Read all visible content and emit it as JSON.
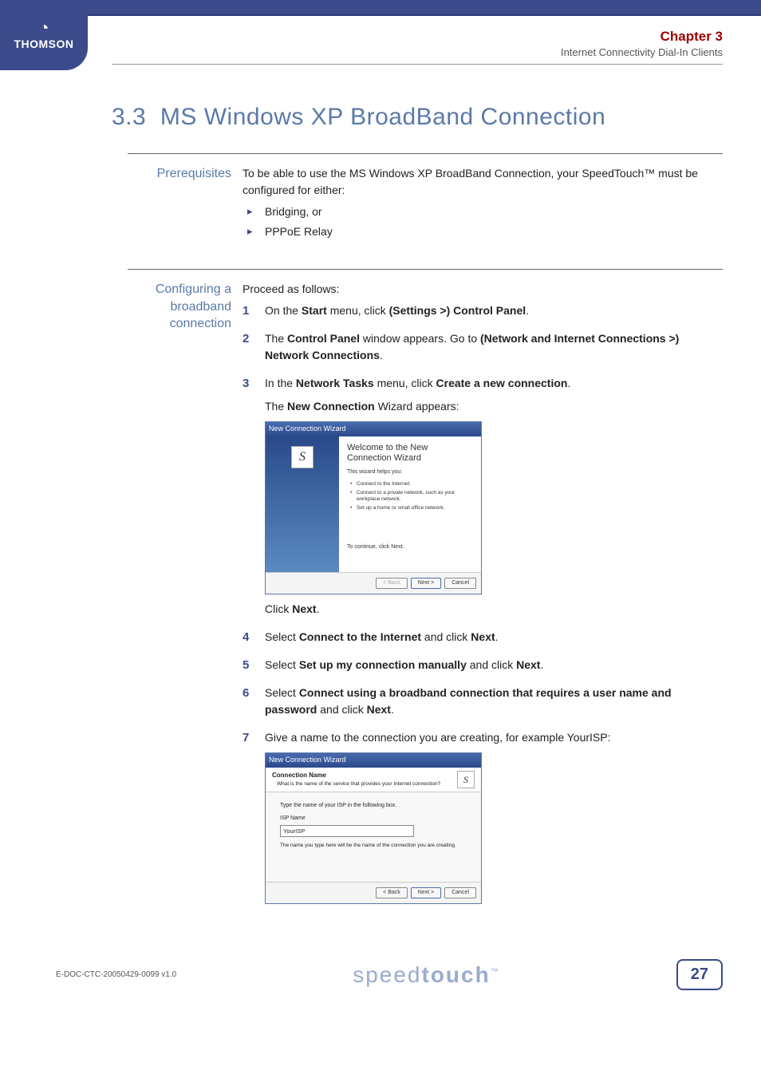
{
  "brand": {
    "logo": "THOMSON",
    "footer_brand_light": "speed",
    "footer_brand_bold": "touch",
    "tm": "™"
  },
  "header": {
    "chapter": "Chapter 3",
    "subtitle": "Internet Connectivity Dial-In Clients"
  },
  "section": {
    "number": "3.3",
    "title": "MS Windows XP BroadBand Connection"
  },
  "prerequisites": {
    "label": "Prerequisites",
    "intro_a": "To be able to use the MS Windows XP BroadBand Connection, your SpeedTouch™ must be configured for either:",
    "items": [
      "Bridging, or",
      "PPPoE Relay"
    ]
  },
  "configuring": {
    "label": "Configuring a broadband connection",
    "intro": "Proceed as follows:",
    "steps": {
      "s1": {
        "a": "On the ",
        "b": "Start",
        "c": " menu, click ",
        "d": "(Settings >) Control Panel",
        "e": "."
      },
      "s2": {
        "a": "The ",
        "b": "Control Panel",
        "c": " window appears. Go to ",
        "d": "(Network and Internet Connections >) Network Connections",
        "e": "."
      },
      "s3": {
        "a": "In the ",
        "b": "Network Tasks",
        "c": " menu, click ",
        "d": "Create a new connection",
        "e": ".",
        "after1a": "The ",
        "after1b": "New Connection",
        "after1c": " Wizard appears:",
        "click_a": "Click ",
        "click_b": "Next",
        "click_c": "."
      },
      "s4": {
        "a": "Select ",
        "b": "Connect to the Internet",
        "c": " and click ",
        "d": "Next",
        "e": "."
      },
      "s5": {
        "a": "Select ",
        "b": "Set up my connection manually",
        "c": " and click ",
        "d": "Next",
        "e": "."
      },
      "s6": {
        "a": "Select ",
        "b": "Connect using a broadband connection that requires a user name and password",
        "c": " and click ",
        "d": "Next",
        "e": "."
      },
      "s7": {
        "a": "Give a name to the connection you are creating, for example YourISP:"
      }
    }
  },
  "wizard1": {
    "titlebar": "New Connection Wizard",
    "welcome": "Welcome to the New Connection Wizard",
    "helps": "This wizard helps you:",
    "bullets": [
      "Connect to the Internet.",
      "Connect to a private network, such as your workplace network.",
      "Set up a home or small office network."
    ],
    "continue": "To continue, click Next.",
    "btn_back": "< Back",
    "btn_next": "Next >",
    "btn_cancel": "Cancel"
  },
  "wizard2": {
    "titlebar": "New Connection Wizard",
    "heading": "Connection Name",
    "sub": "What is the name of the service that provides your Internet connection?",
    "type_label": "Type the name of your ISP in the following box.",
    "isp_label": "ISP Name",
    "isp_value": "YourISP",
    "hint": "The name you type here will be the name of the connection you are creating.",
    "btn_back": "< Back",
    "btn_next": "Next >",
    "btn_cancel": "Cancel"
  },
  "footer": {
    "docid": "E-DOC-CTC-20050429-0099 v1.0",
    "page": "27"
  }
}
